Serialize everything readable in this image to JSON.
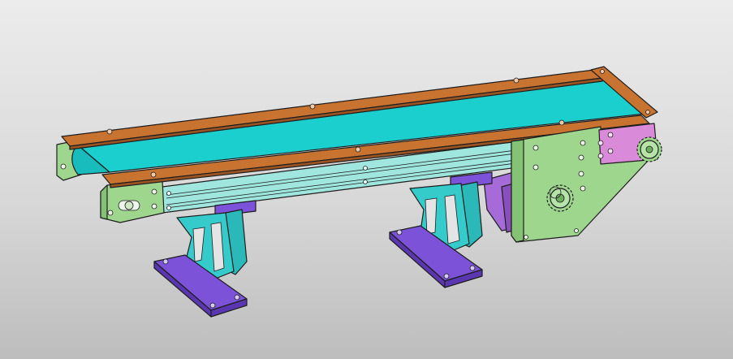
{
  "scene": {
    "colors": {
      "background_top": "#ececec",
      "background_bottom": "#bdbdbd",
      "belt": "#1ccfcf",
      "side_rail": "#c8732f",
      "side_rail_dark": "#9a5322",
      "frame_profile": "#9ee6de",
      "support_leg": "#35cbcb",
      "foot_plate": "#7b52d8",
      "motor_plate": "#9ed68e",
      "end_bracket": "#9ed68e",
      "tensioner_plate": "#d98ad9",
      "gearbox": "#a66bd8",
      "sprocket": "#9ed68e",
      "edge": "#1e1e1e"
    }
  }
}
